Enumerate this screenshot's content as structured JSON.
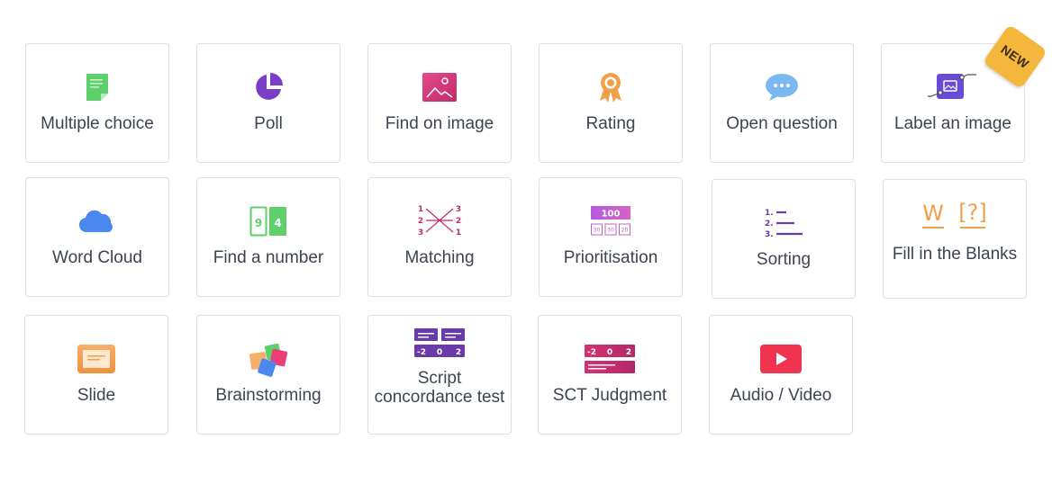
{
  "tiles": [
    {
      "label": "Multiple choice",
      "icon": "multiple-choice-icon"
    },
    {
      "label": "Poll",
      "icon": "poll-icon"
    },
    {
      "label": "Find on image",
      "icon": "image-icon"
    },
    {
      "label": "Rating",
      "icon": "rating-ribbon-icon"
    },
    {
      "label": "Open question",
      "icon": "speech-bubble-icon"
    },
    {
      "label": "Label an image",
      "icon": "label-image-icon",
      "badge": "NEW"
    },
    {
      "label": "Word Cloud",
      "icon": "cloud-icon"
    },
    {
      "label": "Find a number",
      "icon": "find-number-icon",
      "digits": [
        "9",
        "4"
      ]
    },
    {
      "label": "Matching",
      "icon": "matching-icon",
      "left": [
        "1",
        "2",
        "3"
      ],
      "right": [
        "3",
        "2",
        "1"
      ]
    },
    {
      "label": "Prioritisation",
      "icon": "prioritisation-icon",
      "top": "100",
      "small": [
        "30",
        "30",
        "20"
      ]
    },
    {
      "label": "Sorting",
      "icon": "sorting-icon",
      "nums": [
        "1.",
        "2.",
        "3."
      ]
    },
    {
      "label": "Fill in the Blanks",
      "icon": "fill-blanks-icon",
      "glyphs": [
        "W",
        "[?]"
      ]
    },
    {
      "label": "Slide",
      "icon": "slide-icon"
    },
    {
      "label": "Brainstorming",
      "icon": "brainstorming-icon"
    },
    {
      "label": "Script concordance test",
      "icon": "script-concordance-icon",
      "scale": [
        "-2",
        "0",
        "2"
      ]
    },
    {
      "label": "SCT Judgment",
      "icon": "sct-judgment-icon",
      "scale": [
        "-2",
        "0",
        "2"
      ]
    },
    {
      "label": "Audio / Video",
      "icon": "play-video-icon"
    }
  ],
  "colors": {
    "green": "#5fcf6a",
    "purple": "#7b3fc7",
    "magenta": "#d63a7d",
    "orange": "#f0a04a",
    "blue": "#4a88f0",
    "red": "#f0334f",
    "border": "#dcdfe3",
    "text": "#3c4452",
    "badge": "#f5b73b"
  }
}
